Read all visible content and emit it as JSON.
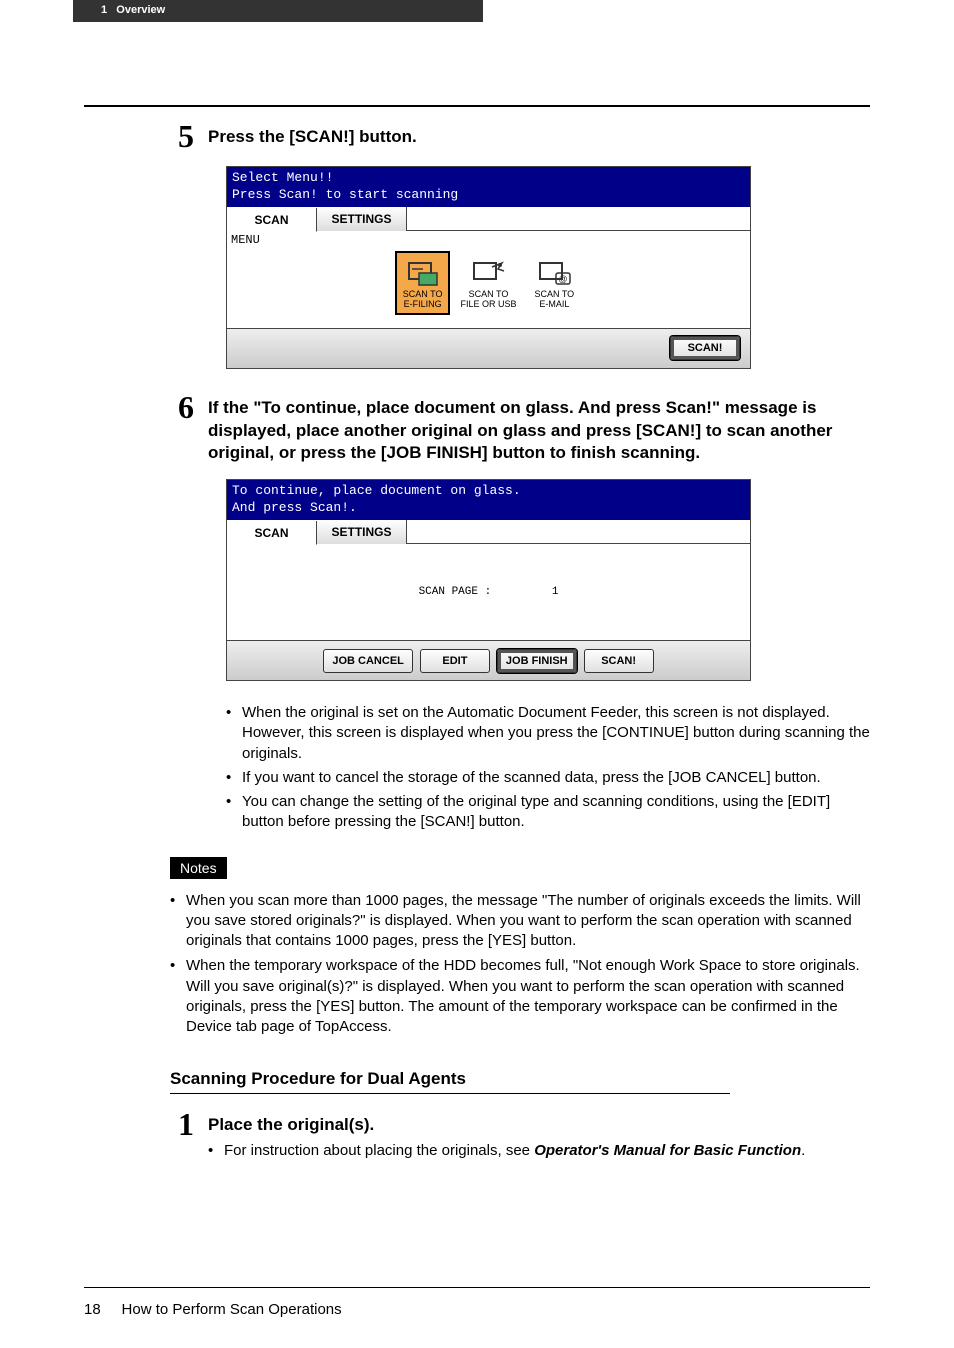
{
  "header": {
    "section_number": "1",
    "section_title": "Overview"
  },
  "step5": {
    "num": "5",
    "title": "Press the [SCAN!] button.",
    "screen": {
      "line1": "Select Menu!!",
      "line2": "Press Scan! to start scanning",
      "tab_scan": "SCAN",
      "tab_settings": "SETTINGS",
      "menu_label": "MENU",
      "icon1": "SCAN TO\nE-FILING",
      "icon2": "SCAN TO\nFILE OR USB",
      "icon3": "SCAN TO\nE-MAIL",
      "btn_scan": "SCAN!"
    }
  },
  "step6": {
    "num": "6",
    "title": "If the \"To continue, place document on glass.  And press Scan!\" message is displayed, place another original on glass and press [SCAN!] to scan another original, or press the [JOB FINISH] button to finish scanning.",
    "screen": {
      "line1": "To continue, place document on glass.",
      "line2": "And press Scan!.",
      "tab_scan": "SCAN",
      "tab_settings": "SETTINGS",
      "scanpage_label": "SCAN PAGE :",
      "scanpage_val": "1",
      "btn_cancel": "JOB CANCEL",
      "btn_edit": "EDIT",
      "btn_finish": "JOB FINISH",
      "btn_scan": "SCAN!"
    },
    "bullets": [
      "When the original is set on the Automatic Document Feeder, this screen is not displayed.  However, this screen is displayed when you press the [CONTINUE] button during scanning the originals.",
      "If you want to cancel the storage of the scanned data, press the [JOB CANCEL] button.",
      "You can change the setting of the original type and scanning conditions, using the [EDIT] button before pressing the [SCAN!] button."
    ]
  },
  "notes": {
    "label": "Notes",
    "items": [
      "When you scan more than 1000 pages, the message \"The number of originals exceeds the limits. Will you save stored originals?\" is displayed.  When you want to perform the scan operation with scanned originals that contains 1000 pages, press the [YES] button.",
      "When the temporary workspace of the HDD becomes full, \"Not enough Work Space to store originals.  Will you save original(s)?\" is displayed.  When you want to perform the scan operation with scanned originals, press the [YES] button.  The amount of the temporary workspace can be confirmed in the Device tab page of TopAccess."
    ]
  },
  "subheading": "Scanning Procedure for Dual Agents",
  "step1": {
    "num": "1",
    "title": "Place the original(s).",
    "sub_prefix": "For instruction about placing the originals, see ",
    "sub_em": "Operator's Manual for Basic Function",
    "sub_suffix": "."
  },
  "footer": {
    "page": "18",
    "title": "How to Perform Scan Operations"
  }
}
